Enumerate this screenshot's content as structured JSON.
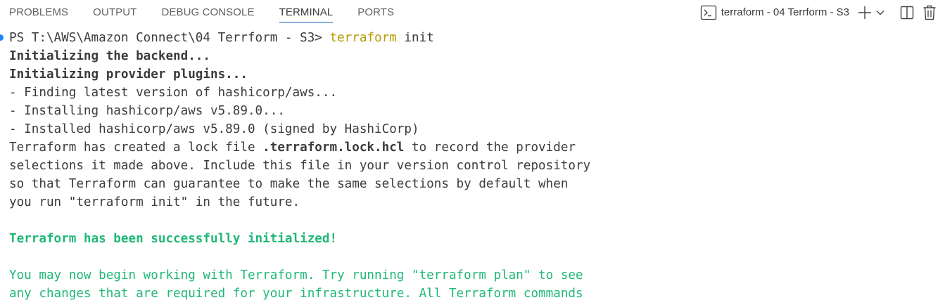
{
  "tabs": [
    {
      "label": "PROBLEMS",
      "active": false
    },
    {
      "label": "OUTPUT",
      "active": false
    },
    {
      "label": "DEBUG CONSOLE",
      "active": false
    },
    {
      "label": "TERMINAL",
      "active": true
    },
    {
      "label": "PORTS",
      "active": false
    }
  ],
  "terminal_instance": {
    "label": "terraform - 04 Terrform - S3",
    "icon": "terminal-icon"
  },
  "actions": [
    "add-icon",
    "chevron-down-icon",
    "split-icon",
    "trash-icon"
  ],
  "prompt": {
    "path": "PS T:\\AWS\\Amazon Connect\\04 Terrform - S3> ",
    "command": "terraform",
    "args": " init"
  },
  "output": {
    "init_backend": "Initializing the backend...",
    "init_plugins": "Initializing provider plugins...",
    "finding": "- Finding latest version of hashicorp/aws...",
    "installing": "- Installing hashicorp/aws v5.89.0...",
    "installed": "- Installed hashicorp/aws v5.89.0 (signed by HashiCorp)",
    "lock_pre": "Terraform has created a lock file ",
    "lock_file": ".terraform.lock.hcl",
    "lock_post": " to record the provider",
    "lock_2": "selections it made above. Include this file in your version control repository",
    "lock_3": "so that Terraform can guarantee to make the same selections by default when",
    "lock_4": "you run \"terraform init\" in the future.",
    "success": "Terraform has been successfully initialized!",
    "next_1": "You may now begin working with Terraform. Try running \"terraform plan\" to see",
    "next_2": "any changes that are required for your infrastructure. All Terraform commands"
  },
  "colors": {
    "accent": "#005fb8",
    "success_green": "#20b877",
    "command_yellow": "#b59b00",
    "prompt_dot": "#1a85ff"
  }
}
